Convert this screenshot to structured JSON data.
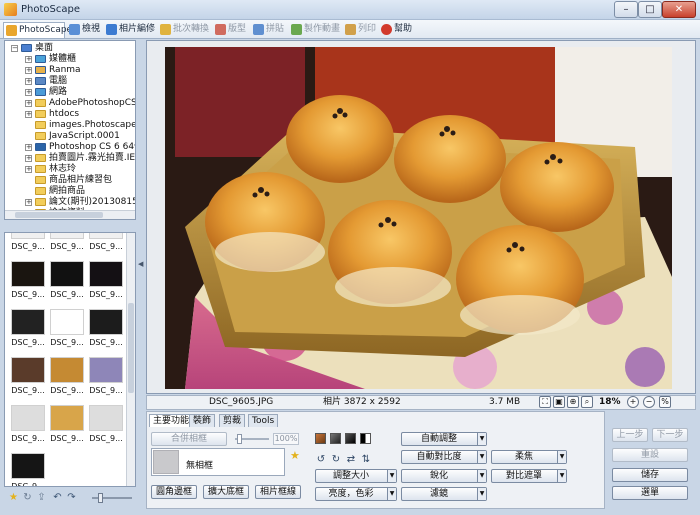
{
  "window": {
    "title": "PhotoScape",
    "controls": {
      "minimize": "–",
      "maximize": "□",
      "close": "✕"
    }
  },
  "toolbar": {
    "tabs": [
      {
        "label": "PhotoScape",
        "state": "active",
        "icon": "photoscape-icon",
        "color": "#e9a62d"
      },
      {
        "label": "檢視",
        "state": "normal",
        "icon": "viewer-icon",
        "color": "#5a8fd6"
      },
      {
        "label": "相片編修",
        "state": "normal",
        "icon": "editor-icon",
        "color": "#3c7bd1"
      },
      {
        "label": "批次轉換",
        "state": "disabled",
        "icon": "batch-icon",
        "color": "#e0b33e"
      },
      {
        "label": "版型",
        "state": "disabled",
        "icon": "page-icon",
        "color": "#d06b5f"
      },
      {
        "label": "拼貼",
        "state": "disabled",
        "icon": "combine-icon",
        "color": "#5f8fd0"
      },
      {
        "label": "製作動畫",
        "state": "disabled",
        "icon": "animated-gif-icon",
        "color": "#6aa84f"
      },
      {
        "label": "列印",
        "state": "disabled",
        "icon": "print-icon",
        "color": "#d1a04a"
      },
      {
        "label": "幫助",
        "state": "normal",
        "icon": "help-icon",
        "color": "#d23a2c"
      }
    ]
  },
  "tree": {
    "items": [
      {
        "label": "桌面",
        "level": 0,
        "expander": "−",
        "icon": "desktop-icon"
      },
      {
        "label": "媒體櫃",
        "level": 1,
        "expander": "+",
        "icon": "library-icon"
      },
      {
        "label": "Ranma",
        "level": 1,
        "expander": "+",
        "icon": "user-folder-icon"
      },
      {
        "label": "電腦",
        "level": 1,
        "expander": "+",
        "icon": "computer-icon"
      },
      {
        "label": "網路",
        "level": 1,
        "expander": "+",
        "icon": "network-icon"
      },
      {
        "label": "AdobePhotoshopCS6",
        "level": 1,
        "expander": "+",
        "icon": "folder-icon"
      },
      {
        "label": "htdocs",
        "level": 1,
        "expander": "+",
        "icon": "folder-icon"
      },
      {
        "label": "images.Photoscape",
        "level": 1,
        "expander": "",
        "icon": "folder-icon"
      },
      {
        "label": "JavaScript.0001",
        "level": 1,
        "expander": "",
        "icon": "folder-icon"
      },
      {
        "label": "Photoshop CS 6 64位",
        "level": 1,
        "expander": "+",
        "icon": "photoshop-icon"
      },
      {
        "label": "拍賣圖片.霧光拍賣.IE",
        "level": 1,
        "expander": "+",
        "icon": "folder-icon"
      },
      {
        "label": "林志玲",
        "level": 1,
        "expander": "+",
        "icon": "folder-icon"
      },
      {
        "label": "商品相片練習包",
        "level": 1,
        "expander": "",
        "icon": "folder-icon"
      },
      {
        "label": "網拍商品",
        "level": 1,
        "expander": "",
        "icon": "folder-icon"
      },
      {
        "label": "論文(期刊)20130815",
        "level": 1,
        "expander": "+",
        "icon": "folder-icon"
      },
      {
        "label": "論文資料",
        "level": 1,
        "expander": "+",
        "icon": "folder-icon"
      }
    ]
  },
  "thumbnails": {
    "items": [
      {
        "label": "DSC_9...",
        "color": "#f0f0f0"
      },
      {
        "label": "DSC_9...",
        "color": "#f0f0f0"
      },
      {
        "label": "DSC_9...",
        "color": "#f0f0f0"
      },
      {
        "label": "DSC_9...",
        "color": "#1a1510"
      },
      {
        "label": "DSC_9...",
        "color": "#111"
      },
      {
        "label": "DSC_9...",
        "color": "#141014"
      },
      {
        "label": "DSC_9...",
        "color": "#222"
      },
      {
        "label": "DSC_9...",
        "color": "#fff"
      },
      {
        "label": "DSC_9...",
        "color": "#1c1c1c"
      },
      {
        "label": "DSC_9...",
        "color": "#5a3b2a"
      },
      {
        "label": "DSC_9...",
        "color": "#c58a33"
      },
      {
        "label": "DSC_9...",
        "color": "#8e86b8"
      },
      {
        "label": "DSC_9...",
        "color": "#ddd"
      },
      {
        "label": "DSC_9...",
        "color": "#d8a54a"
      },
      {
        "label": "DSC_9...",
        "color": "#ddd"
      },
      {
        "label": "DSC_9...",
        "color": "#151515"
      }
    ]
  },
  "viewer": {
    "filename": "DSC_9605.JPG",
    "size": "相片 3872 x 2592",
    "filesize": "3.7 MB",
    "zoom": "18%"
  },
  "editor": {
    "tabs": [
      "主要功能",
      "裝飾",
      "剪裁",
      "Tools"
    ],
    "merge_frame": "合併相框",
    "opacity": "100%",
    "frame_value": "無相框",
    "buttons": {
      "round_frame": "圓角邊框",
      "enlarge_canvas": "擴大底框",
      "photo_frame": "相片框線",
      "auto_level": "自動調整",
      "auto_contrast": "自動對比度",
      "sharpen": "銳化",
      "filter": "濾鏡",
      "resize": "調整大小",
      "brightness": "亮度，色彩",
      "soften": "柔焦",
      "backlight": "對比遮罩"
    },
    "side": {
      "undo": "上一步",
      "redo": "下一步",
      "reset": "重設",
      "save": "儲存",
      "menu": "選單"
    }
  },
  "colors": {
    "accent": "#3c7bd1",
    "panel": "#eef1f5",
    "chrome": "#c9d6e6"
  }
}
